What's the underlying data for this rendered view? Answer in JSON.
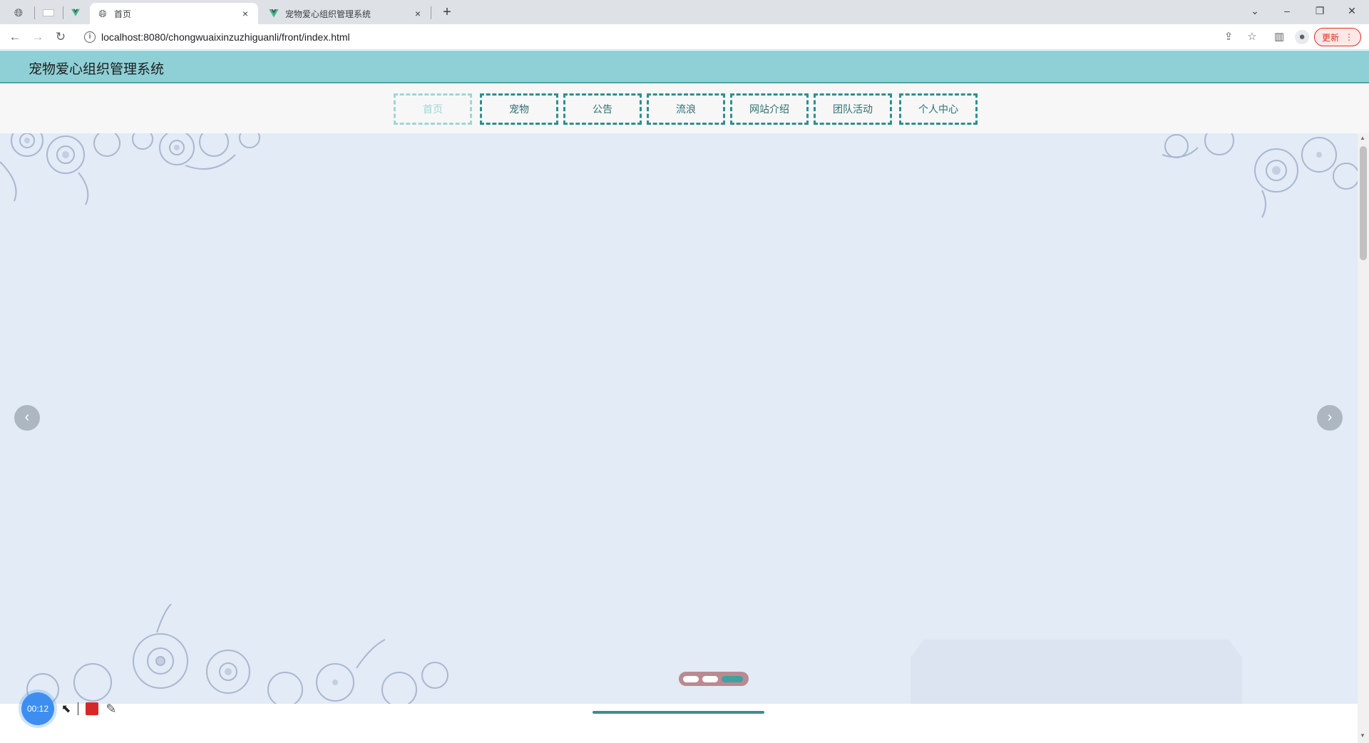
{
  "browser": {
    "tabs": [
      {
        "title": "首页",
        "active": true
      },
      {
        "title": "宠物爱心组织管理系统",
        "active": false
      }
    ],
    "address": "localhost:8080/chongwuaixinzuzhiguanli/front/index.html",
    "update_label": "更新",
    "new_tab_label": "+",
    "close_label": "×",
    "minimize_label": "–",
    "restore_label": "❐",
    "window_close_label": "✕"
  },
  "site": {
    "title": "宠物爱心组织管理系统",
    "nav": [
      {
        "label": "首页",
        "active": true
      },
      {
        "label": "宠物",
        "active": false
      },
      {
        "label": "公告",
        "active": false
      },
      {
        "label": "流浪",
        "active": false
      },
      {
        "label": "网站介绍",
        "active": false
      },
      {
        "label": "团队活动",
        "active": false
      },
      {
        "label": "个人中心",
        "active": false
      }
    ],
    "carousel": {
      "slide_count": 3,
      "active_index": 2,
      "prev_label": "‹",
      "next_label": "›"
    }
  },
  "recorder": {
    "timer": "00:12"
  },
  "colors": {
    "header_bg": "#8ed0d6",
    "accent": "#2f8f8f",
    "banner_bg": "#e2ebf6",
    "update_red": "#d93025"
  }
}
